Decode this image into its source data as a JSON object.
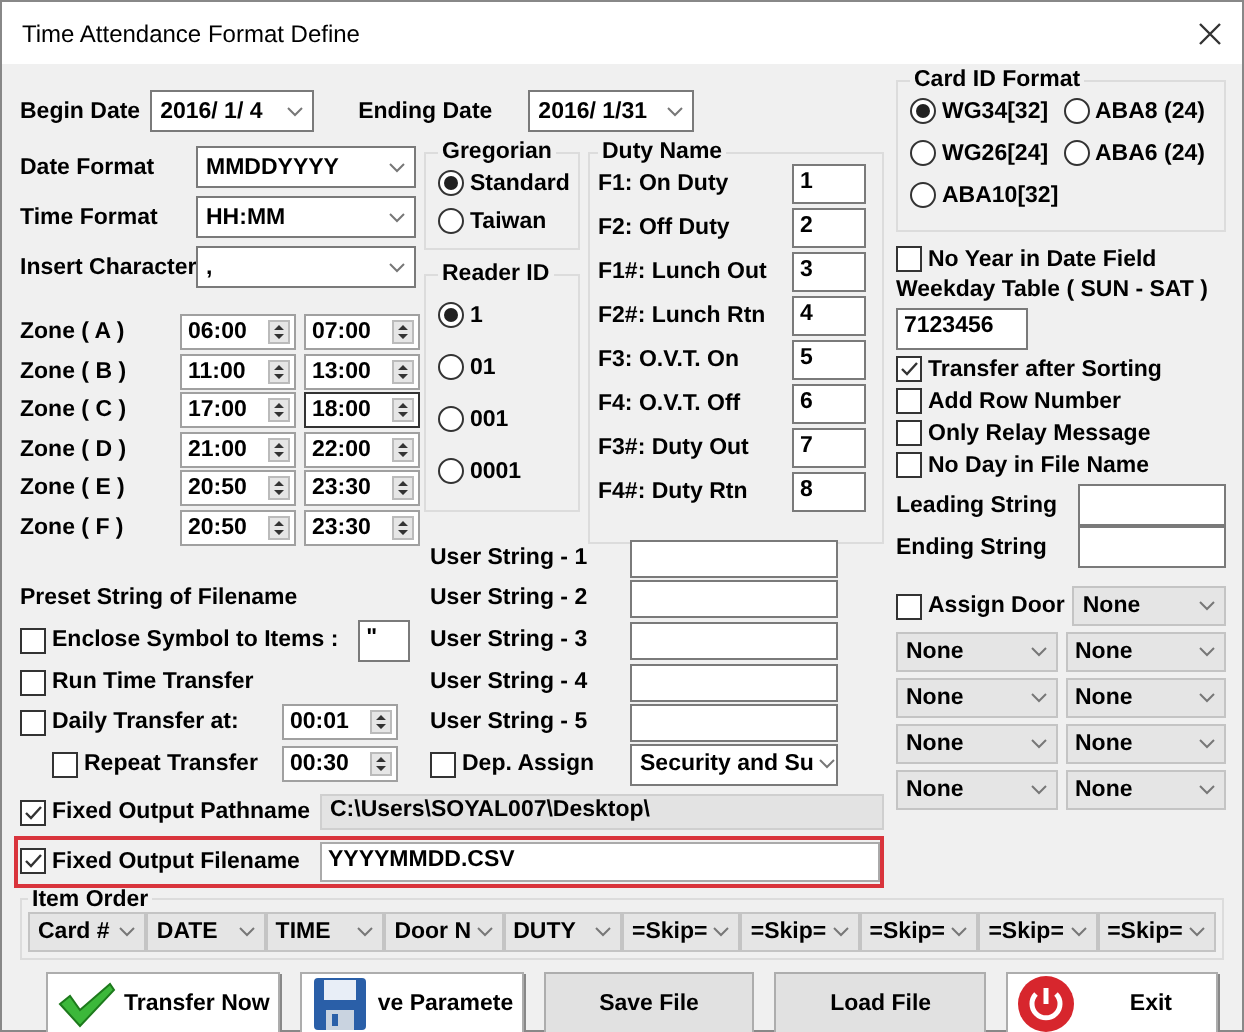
{
  "window": {
    "title": "Time Attendance Format Define"
  },
  "begin_date": {
    "label": "Begin Date",
    "value": "2016/ 1/ 4"
  },
  "ending_date": {
    "label": "Ending Date",
    "value": "2016/ 1/31"
  },
  "formats": [
    {
      "label": "Date Format",
      "value": "MMDDYYYY"
    },
    {
      "label": "Time Format",
      "value": "HH:MM"
    },
    {
      "label": "Insert Character",
      "value": ","
    }
  ],
  "zones": [
    {
      "label": "Zone ( A )",
      "start": "06:00",
      "end": "07:00"
    },
    {
      "label": "Zone ( B )",
      "start": "11:00",
      "end": "13:00"
    },
    {
      "label": "Zone ( C )",
      "start": "17:00",
      "end": "18:00"
    },
    {
      "label": "Zone ( D )",
      "start": "21:00",
      "end": "22:00"
    },
    {
      "label": "Zone ( E )",
      "start": "20:50",
      "end": "23:30"
    },
    {
      "label": "Zone ( F )",
      "start": "20:50",
      "end": "23:30"
    }
  ],
  "gregorian": {
    "title": "Gregorian",
    "options": [
      {
        "label": "Standard",
        "selected": true
      },
      {
        "label": "Taiwan",
        "selected": false
      }
    ]
  },
  "reader_id": {
    "title": "Reader ID",
    "options": [
      {
        "label": "1",
        "selected": true
      },
      {
        "label": "01",
        "selected": false
      },
      {
        "label": "001",
        "selected": false
      },
      {
        "label": "0001",
        "selected": false
      }
    ]
  },
  "duty_name": {
    "title": "Duty Name",
    "items": [
      {
        "label": "F1: On Duty",
        "value": "1"
      },
      {
        "label": "F2: Off Duty",
        "value": "2"
      },
      {
        "label": "F1#: Lunch Out",
        "value": "3"
      },
      {
        "label": "F2#: Lunch Rtn",
        "value": "4"
      },
      {
        "label": "F3: O.V.T. On",
        "value": "5"
      },
      {
        "label": "F4: O.V.T. Off",
        "value": "6"
      },
      {
        "label": "F3#: Duty Out",
        "value": "7"
      },
      {
        "label": "F4#: Duty Rtn",
        "value": "8"
      }
    ]
  },
  "card_id_format": {
    "title": "Card ID Format",
    "options": [
      {
        "label": "WG34[32]",
        "selected": true
      },
      {
        "label": "ABA8 (24)",
        "selected": false
      },
      {
        "label": "WG26[24]",
        "selected": false
      },
      {
        "label": "ABA6 (24)",
        "selected": false
      },
      {
        "label": "ABA10[32]",
        "selected": false
      }
    ]
  },
  "no_year": {
    "label": "No Year in Date Field",
    "checked": false
  },
  "weekday_table": {
    "label": "Weekday Table ( SUN - SAT )",
    "value": "7123456"
  },
  "sort_options": [
    {
      "label": "Transfer after Sorting",
      "checked": true
    },
    {
      "label": "Add Row Number",
      "checked": false
    },
    {
      "label": "Only Relay Message",
      "checked": false
    },
    {
      "label": "No Day in File Name",
      "checked": false
    }
  ],
  "leading_string": {
    "label": "Leading String"
  },
  "ending_string": {
    "label": "Ending String"
  },
  "assign_door": {
    "label": "Assign Door",
    "checked": false,
    "value": "None"
  },
  "door_selects": [
    {
      "left": "None",
      "right": "None"
    },
    {
      "left": "None",
      "right": "None"
    },
    {
      "left": "None",
      "right": "None"
    },
    {
      "left": "None",
      "right": "None"
    }
  ],
  "preset_string": {
    "label": "Preset String of Filename"
  },
  "enclose_symbol": {
    "label": "Enclose Symbol to Items :",
    "checked": false,
    "value": "\""
  },
  "run_time_transfer": {
    "label": "Run Time Transfer",
    "checked": false
  },
  "daily_transfer": {
    "label": "Daily Transfer at:",
    "checked": false,
    "value": "00:01"
  },
  "repeat_transfer": {
    "label": "Repeat Transfer",
    "checked": false,
    "value": "00:30"
  },
  "user_strings": [
    {
      "label": "User String - 1"
    },
    {
      "label": "User String - 2"
    },
    {
      "label": "User String - 3"
    },
    {
      "label": "User String - 4"
    },
    {
      "label": "User String - 5"
    }
  ],
  "dep_assign": {
    "label": "Dep. Assign",
    "checked": false,
    "value": "Security and Su"
  },
  "output_pathname": {
    "label": "Fixed Output Pathname",
    "checked": true,
    "value": "C:\\Users\\SOYAL007\\Desktop\\"
  },
  "output_filename": {
    "label": "Fixed Output Filename",
    "checked": true,
    "value": "YYYYMMDD.CSV",
    "highlighted": true
  },
  "item_order": {
    "title": "Item Order",
    "items": [
      "Card #",
      "DATE",
      "TIME",
      "Door N",
      "DUTY",
      "=Skip=",
      "=Skip=",
      "=Skip=",
      "=Skip=",
      "=Skip="
    ]
  },
  "buttons": [
    {
      "label": "Transfer Now",
      "kind": "transfer"
    },
    {
      "label": "ve Paramete",
      "kind": "save"
    },
    {
      "label": "Save File",
      "kind": "plain"
    },
    {
      "label": "Load File",
      "kind": "plain"
    },
    {
      "label": "Exit",
      "kind": "exit"
    }
  ]
}
